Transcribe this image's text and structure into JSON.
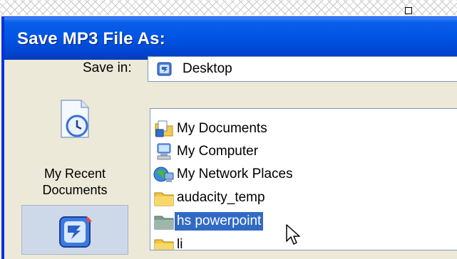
{
  "window": {
    "title": "Save MP3 File As:"
  },
  "save_in": {
    "label": "Save in:",
    "value": "Desktop",
    "icon": "desktop-icon"
  },
  "places_bar": [
    {
      "label": "My Recent Documents",
      "line1": "My Recent",
      "line2": "Documents",
      "icon": "recent-documents-icon"
    },
    {
      "label": "Desktop",
      "icon": "desktop-icon",
      "selected": true
    }
  ],
  "file_list": [
    {
      "label": "My Documents",
      "icon": "my-documents-icon",
      "selected": false
    },
    {
      "label": "My Computer",
      "icon": "my-computer-icon",
      "selected": false
    },
    {
      "label": "My Network Places",
      "icon": "network-places-icon",
      "selected": false
    },
    {
      "label": "audacity_temp",
      "icon": "folder-icon",
      "selected": false
    },
    {
      "label": "hs powerpoint",
      "icon": "folder-icon",
      "selected": true
    },
    {
      "label": "li",
      "icon": "folder-icon",
      "selected": false
    }
  ],
  "colors": {
    "title_bar": "#0055e5",
    "selection": "#316ac5",
    "dialog_face": "#ece9d8"
  }
}
